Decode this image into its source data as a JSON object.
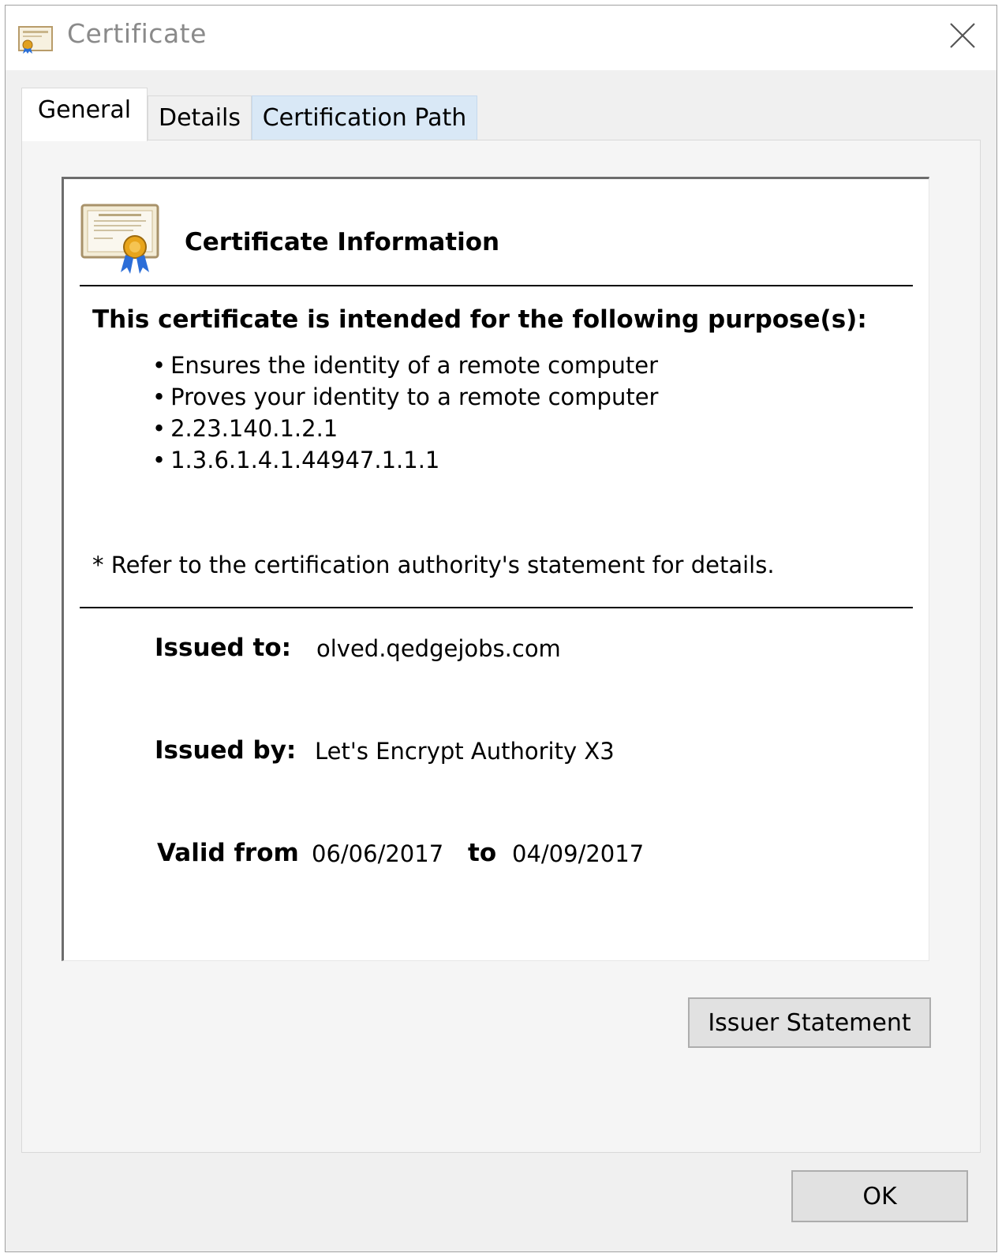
{
  "window": {
    "title": "Certificate",
    "title_icon": "certificate-icon",
    "close_icon": "close-icon"
  },
  "tabs": [
    {
      "label": "General",
      "active": true
    },
    {
      "label": "Details",
      "active": false
    },
    {
      "label": "Certification Path",
      "active": false
    }
  ],
  "info": {
    "heading": "Certificate Information",
    "icon": "certificate-seal-icon",
    "purpose_heading": "This certificate is intended for the following purpose(s):",
    "purposes": [
      "Ensures the identity of a remote computer",
      "Proves your identity to a remote computer",
      "2.23.140.1.2.1",
      "1.3.6.1.4.1.44947.1.1.1"
    ],
    "footnote": "* Refer to the certification authority's statement for details.",
    "issued_to_label": "Issued to:",
    "issued_to": "olved.qedgejobs.com",
    "issued_by_label": "Issued by:",
    "issued_by": "Let's Encrypt Authority X3",
    "valid_from_label": "Valid from",
    "valid_from": "06/06/2017",
    "valid_to_label": "to",
    "valid_to": "04/09/2017"
  },
  "buttons": {
    "issuer_statement": "Issuer Statement",
    "ok": "OK"
  },
  "colors": {
    "window_bg": "#f0f0f0",
    "panel_bg": "#ffffff",
    "tab_highlight": "#d9e8f6",
    "button_bg": "#e1e1e1",
    "title_text": "#8a8a8a"
  }
}
